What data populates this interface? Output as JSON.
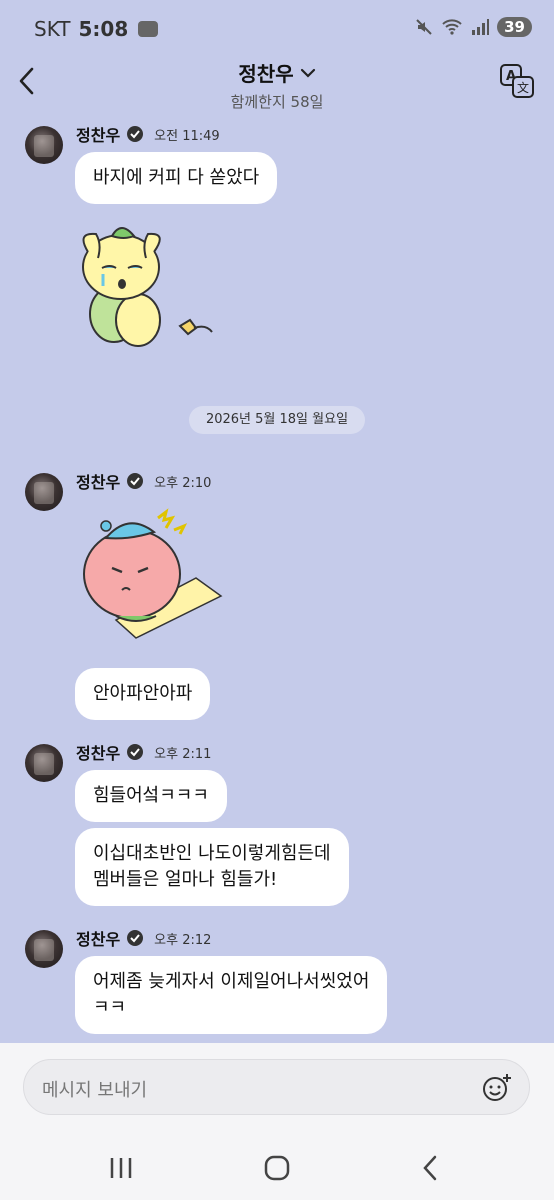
{
  "status": {
    "carrier": "SKT",
    "time": "5:08",
    "battery": "39"
  },
  "header": {
    "title": "정찬우",
    "subtitle": "함께한지 58일"
  },
  "groups": [
    {
      "sender": "정찬우",
      "time": "오전 11:49",
      "messages": [
        "바지에 커피 다 쏟았다"
      ]
    },
    {
      "sender": "정찬우",
      "time": "오후 2:10",
      "messages": [
        "안아파안아파"
      ]
    },
    {
      "sender": "정찬우",
      "time": "오후 2:11",
      "messages": [
        "힘들어섴ㅋㅋㅋ",
        "이십대초반인 나도이렇게힘든데\n멤버들은 얼마나 힘들가!"
      ]
    },
    {
      "sender": "정찬우",
      "time": "오후 2:12",
      "messages": [
        "어제좀 늦게자서 이제일어나서씻었어\nㅋㅋ"
      ]
    }
  ],
  "date_divider": "2026년 5월 18일 월요일",
  "input": {
    "placeholder": "메시지 보내기"
  },
  "icons": [
    "back-icon",
    "chevron-down-icon",
    "translate-icon",
    "verified-icon",
    "emoji-add-icon",
    "recent-apps-icon",
    "home-icon",
    "nav-back-icon"
  ]
}
